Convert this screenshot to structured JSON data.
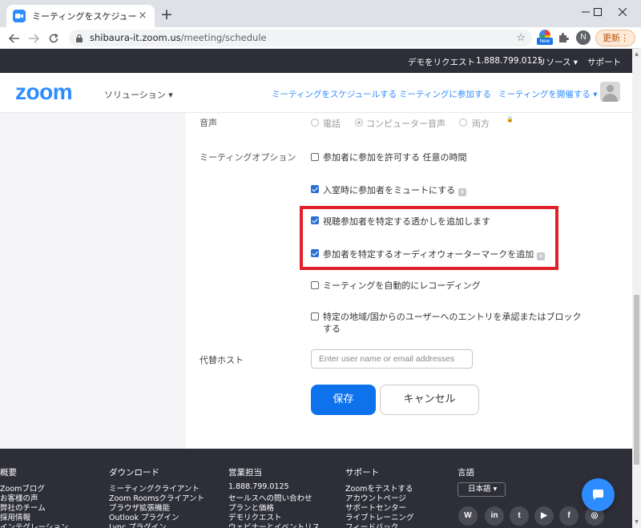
{
  "browser": {
    "tab_title": "ミーティングをスケジュールする - Zoom",
    "tab_close": "×",
    "new_tab": "+",
    "url_host": "shibaura-it.zoom.us",
    "url_path": "/meeting/schedule",
    "ext_badge": "New",
    "profile_initial": "N",
    "update_label": "更新",
    "update_dots": "⋮",
    "star": "☆"
  },
  "topbar": {
    "request_demo": "デモをリクエスト",
    "phone": "1.888.799.0125",
    "resources": "リソース ▾",
    "support": "サポート"
  },
  "nav": {
    "logo": "zoom",
    "solutions": "ソリューション ▾",
    "schedule": "ミーティングをスケジュールする",
    "join": "ミーティングに参加する",
    "host": "ミーティングを開催する ▾"
  },
  "form": {
    "audio_label": "音声",
    "audio_options": [
      "電話",
      "コンピューター音声",
      "両方"
    ],
    "audio_selected": "コンピューター音声",
    "lock_glyph": "🔒",
    "meeting_options_label": "ミーティングオプション",
    "options": [
      {
        "label": "参加者に参加を許可する 任意の時間",
        "checked": false
      },
      {
        "label": "入室時に参加者をミュートにする",
        "checked": true
      },
      {
        "label": "視聴参加者を特定する透かしを追加します",
        "checked": true
      },
      {
        "label": "参加者を特定するオーディオウォーターマークを追加",
        "checked": true
      },
      {
        "label": "ミーティングを自動的にレコーディング",
        "checked": false
      },
      {
        "label": "特定の地域/国からのユーザーへのエントリを承認またはブロック",
        "checked": false
      }
    ],
    "option6_line2": "する",
    "info_glyph": "×",
    "alt_host_label": "代替ホスト",
    "alt_host_placeholder": "Enter user name or email addresses",
    "save_label": "保存",
    "cancel_label": "キャンセル"
  },
  "footer": {
    "col1": {
      "heading": "概要",
      "links": [
        "Zoomブログ",
        "お客様の声",
        "弊社のチーム",
        "採用情報",
        "インテグレーション"
      ]
    },
    "col2": {
      "heading": "ダウンロード",
      "links": [
        "ミーティングクライアント",
        "Zoom Roomsクライアント",
        "ブラウザ拡張機能",
        "Outlook プラグイン",
        "Lync プラグイン"
      ]
    },
    "col3": {
      "heading": "営業担当",
      "links": [
        "1.888.799.0125",
        "セールスへの問い合わせ",
        "プランと価格",
        "デモリクエスト",
        "ウェビナーとイベントリス"
      ]
    },
    "col4": {
      "heading": "サポート",
      "links": [
        "Zoomをテストする",
        "アカウントページ",
        "サポートセンター",
        "ライブトレーニング",
        "フィードバック"
      ]
    },
    "col5": {
      "heading": "言語",
      "language": "日本語 ▾"
    },
    "social": [
      "W",
      "in",
      "t",
      "▶",
      "f",
      "◎"
    ]
  },
  "colors": {
    "zoom_blue": "#2d8cff",
    "dark_bar": "#2d2e38",
    "highlight_red": "#e0202a",
    "save_blue": "#0e72ed"
  }
}
